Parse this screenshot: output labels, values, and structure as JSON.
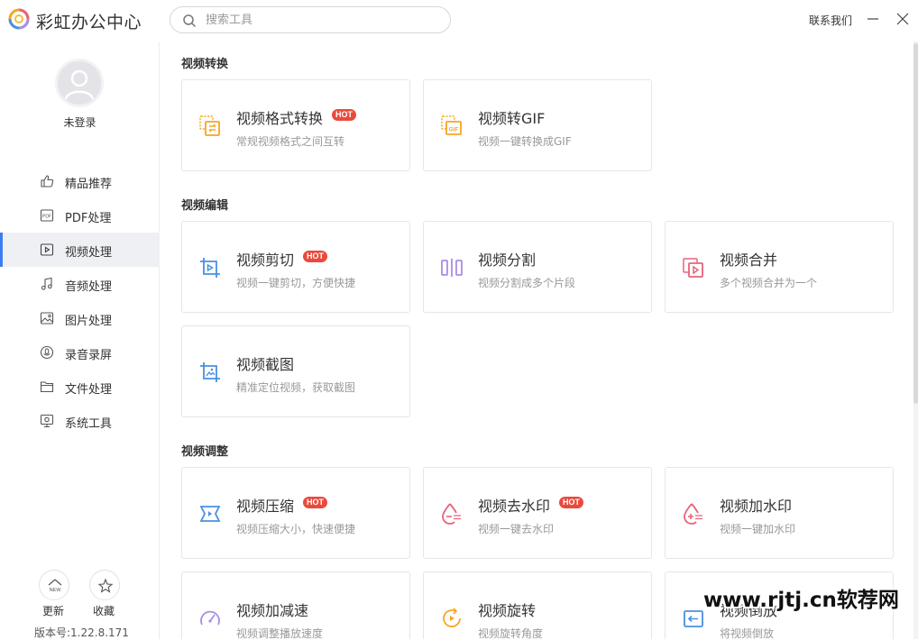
{
  "app": {
    "title": "彩虹办公中心"
  },
  "search": {
    "placeholder": "搜索工具"
  },
  "header": {
    "contact": "联系我们"
  },
  "user": {
    "status": "未登录"
  },
  "nav": [
    {
      "label": "精品推荐",
      "icon": "thumbs-up-icon"
    },
    {
      "label": "PDF处理",
      "icon": "pdf-icon"
    },
    {
      "label": "视频处理",
      "icon": "video-icon",
      "active": true
    },
    {
      "label": "音频处理",
      "icon": "music-note-icon"
    },
    {
      "label": "图片处理",
      "icon": "image-icon"
    },
    {
      "label": "录音录屏",
      "icon": "record-icon"
    },
    {
      "label": "文件处理",
      "icon": "folder-icon"
    },
    {
      "label": "系统工具",
      "icon": "monitor-gear-icon"
    }
  ],
  "sidebar_bottom": {
    "update": "更新",
    "favorite": "收藏",
    "version": "版本号:1.22.8.171"
  },
  "badge": "HOT",
  "sections": [
    {
      "title": "视频转换",
      "cards": [
        {
          "title": "视频格式转换",
          "desc": "常规视频格式之间互转",
          "hot": true
        },
        {
          "title": "视频转GIF",
          "desc": "视频一键转换成GIF",
          "hot": false
        }
      ]
    },
    {
      "title": "视频编辑",
      "cards": [
        {
          "title": "视频剪切",
          "desc": "视频一键剪切，方便快捷",
          "hot": true
        },
        {
          "title": "视频分割",
          "desc": "视频分割成多个片段",
          "hot": false
        },
        {
          "title": "视频合并",
          "desc": "多个视频合并为一个",
          "hot": false
        },
        {
          "title": "视频截图",
          "desc": "精准定位视频，获取截图",
          "hot": false
        }
      ]
    },
    {
      "title": "视频调整",
      "cards": [
        {
          "title": "视频压缩",
          "desc": "视频压缩大小，快速便捷",
          "hot": true
        },
        {
          "title": "视频去水印",
          "desc": "视频一键去水印",
          "hot": true
        },
        {
          "title": "视频加水印",
          "desc": "视频一键加水印",
          "hot": false
        },
        {
          "title": "视频加减速",
          "desc": "视频调整播放速度",
          "hot": false
        },
        {
          "title": "视频旋转",
          "desc": "视频旋转角度",
          "hot": false
        },
        {
          "title": "视频倒放",
          "desc": "将视频倒放",
          "hot": false
        }
      ]
    }
  ],
  "watermark": "www.rjtj.cn软荐网",
  "colors": {
    "accent": "#3b7cf0",
    "hot": "#ea4a3c",
    "orange": "#f5a623",
    "purple": "#a98ce8",
    "red": "#e8637a",
    "blue": "#4a90e2"
  }
}
